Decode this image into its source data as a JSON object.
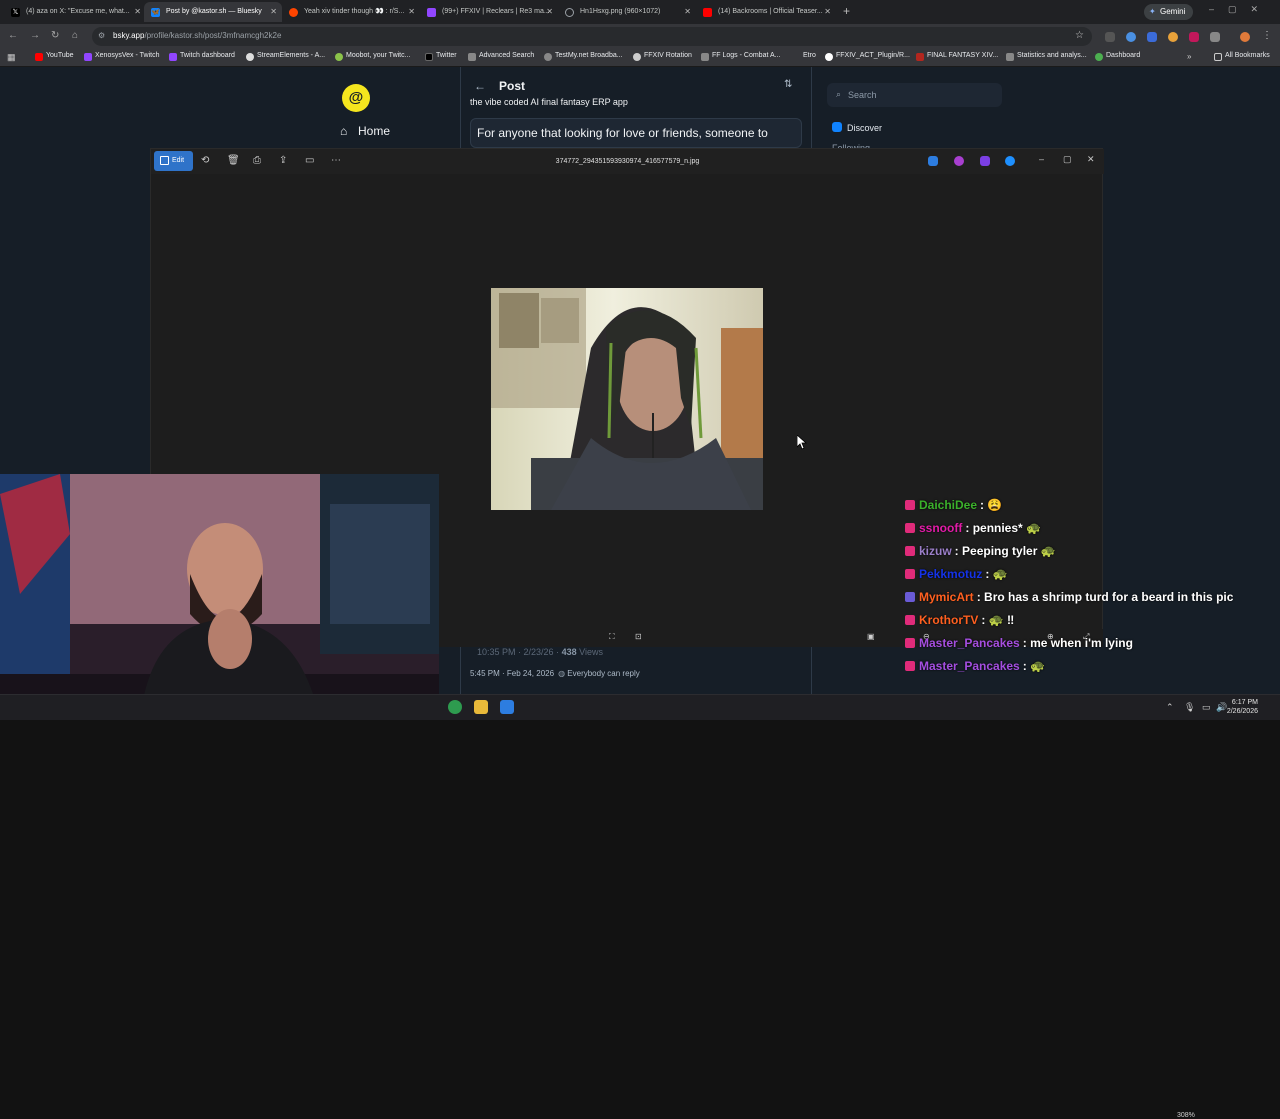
{
  "browser": {
    "tabs": [
      {
        "label": "(4) aza on X: \"Excuse me, what...",
        "icon": "x-logo-icon",
        "color": "#000000"
      },
      {
        "label": "Post by @kastor.sh — Bluesky",
        "icon": "bluesky-icon",
        "color": "#1083fe"
      },
      {
        "label": "Yeah xiv tinder though 👀 : r/S...",
        "icon": "reddit-icon",
        "color": "#ff4500"
      },
      {
        "label": "(99+) FFXIV | Reclears | Re3 ma...",
        "icon": "twitch-icon",
        "color": "#9146ff"
      },
      {
        "label": "Hn1Hsxg.png (960×1072)",
        "icon": "globe-icon",
        "color": "#5f6368"
      },
      {
        "label": "(14) Backrooms | Official Teaser...",
        "icon": "youtube-icon",
        "color": "#ff0000"
      }
    ],
    "gemini_label": "Gemini",
    "url_host": "bsky.app",
    "url_path": "/profile/kastor.sh/post/3mfnamcgh2k2e",
    "bookmarks": [
      {
        "label": "YouTube",
        "color": "#ff0000"
      },
      {
        "label": "XenosysVex - Twitch",
        "color": "#9146ff"
      },
      {
        "label": "Twitch dashboard",
        "color": "#9146ff"
      },
      {
        "label": "StreamElements - A...",
        "color": "#dddddd"
      },
      {
        "label": "Moobot, your Twitc...",
        "color": "#8bc34a"
      },
      {
        "label": "Twitter",
        "color": "#000000"
      },
      {
        "label": "Advanced Search",
        "color": "#888888"
      },
      {
        "label": "TestMy.net Broadba...",
        "color": "#888888"
      },
      {
        "label": "FFXIV Rotation",
        "color": "#cccccc"
      },
      {
        "label": "FF Logs - Combat A...",
        "color": "#888888"
      },
      {
        "label": "Etro",
        "color": "#888888"
      },
      {
        "label": "FFXIV_ACT_Plugin/R...",
        "color": "#ffffff"
      },
      {
        "label": "FINAL FANTASY XIV...",
        "color": "#b3261e"
      },
      {
        "label": "Statistics and analys...",
        "color": "#888888"
      },
      {
        "label": "Dashboard",
        "color": "#4caf50"
      }
    ],
    "all_bookmarks_label": "All Bookmarks"
  },
  "bluesky": {
    "home_label": "Home",
    "post_header": "Post",
    "post_line": "the vibe coded AI final fantasy ERP app",
    "post_card_text": "For anyone that looking for love or  friends, someone to",
    "search_placeholder": "Search",
    "discover_label": "Discover",
    "following_label": "Following",
    "meta_time": "10:35 PM · 2/23/26 ·",
    "meta_views": "438",
    "meta_views_label": "Views",
    "post_timestamp": "5:45 PM · Feb 24, 2026",
    "reply_setting": "Everybody can reply"
  },
  "viewer": {
    "edit_label": "Edit",
    "filename": "374772_294351593930974_416577579_n.jpg",
    "zoom": "308%"
  },
  "chat": [
    {
      "user": "DaichiDee",
      "color": "#3bb02b",
      "text": "😩",
      "badge": "#e02b7a"
    },
    {
      "user": "ssnooff",
      "color": "#e21ca8",
      "text": "pennies* 🐢",
      "badge": "#e02b7a"
    },
    {
      "user": "kizuw",
      "color": "#9b7fc9",
      "text": "Peeping tyler 🐢",
      "badge": "#e02b7a"
    },
    {
      "user": "Pekkmotuz",
      "color": "#1533e8",
      "text": "🐢",
      "badge": "#e02b7a"
    },
    {
      "user": "MymicArt",
      "color": "#ff6020",
      "text": "Bro has a shrimp turd for a beard in this pic",
      "badge": "#6a5bd6"
    },
    {
      "user": "KrothorTV",
      "color": "#ff6020",
      "text": "🐢 ‼",
      "badge": "#e02b7a"
    },
    {
      "user": "Master_Pancakes",
      "color": "#a44ee0",
      "text": "me when i'm lying",
      "badge": "#e02b7a"
    },
    {
      "user": "Master_Pancakes",
      "color": "#a44ee0",
      "text": "🐢",
      "badge": "#e02b7a"
    }
  ],
  "taskbar": {
    "time": "6:17 PM",
    "date": "2/26/2026"
  }
}
